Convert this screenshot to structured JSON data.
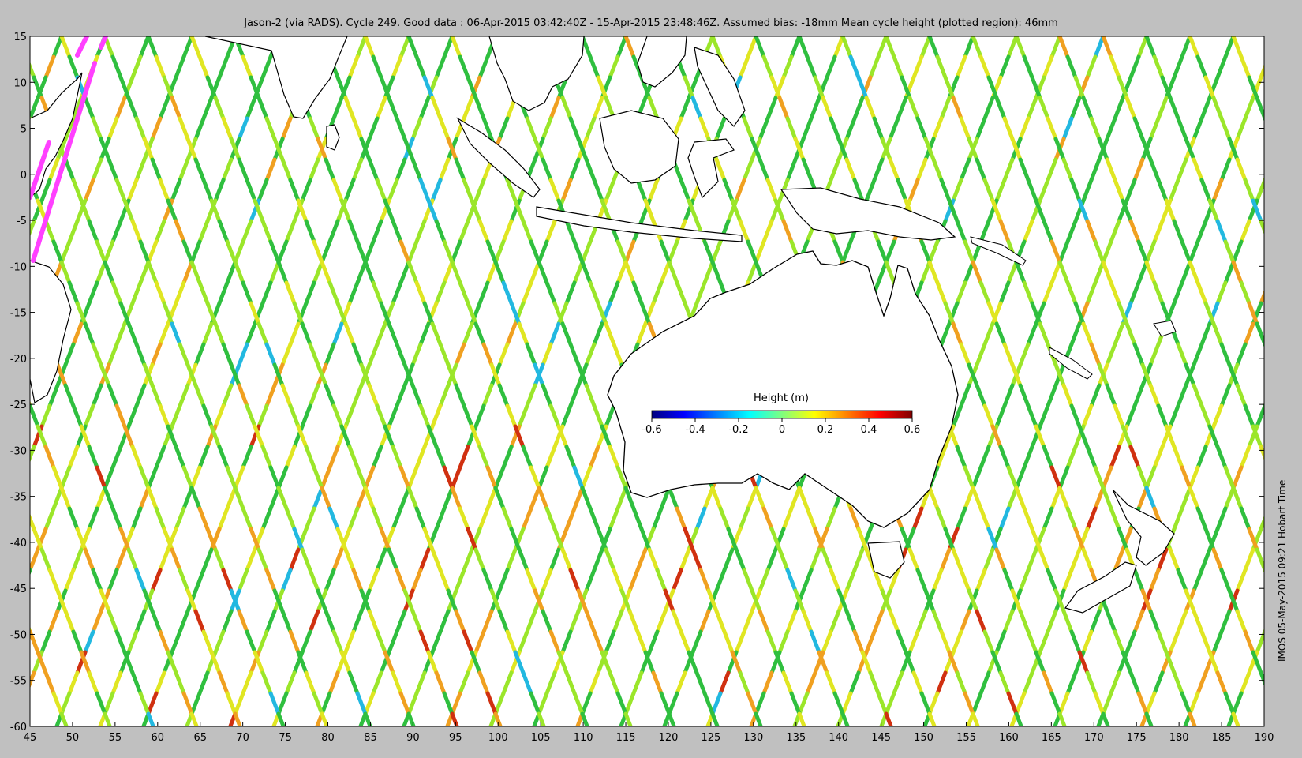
{
  "title": "Jason-2 (via RADS). Cycle 249. Good data : 06-Apr-2015 03:42:40Z - 15-Apr-2015 23:48:46Z. Assumed bias: -18mm  Mean cycle height (plotted region): 46mm",
  "side_label": "IMOS 05-May-2015 09:21 Hobart Time",
  "colorbar": {
    "title": "Height (m)",
    "ticks": [
      "-0.6",
      "-0.4",
      "-0.2",
      "0",
      "0.2",
      "0.4",
      "0.6"
    ],
    "range": [
      -0.6,
      0.6
    ],
    "colors": [
      "#00007f",
      "#0000ff",
      "#007fff",
      "#00ffff",
      "#7fff7f",
      "#ffff00",
      "#ff7f00",
      "#ff0000",
      "#7f0000"
    ]
  },
  "axes": {
    "x_ticks": [
      "45",
      "50",
      "55",
      "60",
      "65",
      "70",
      "75",
      "80",
      "85",
      "90",
      "95",
      "100",
      "105",
      "110",
      "115",
      "120",
      "125",
      "130",
      "135",
      "140",
      "145",
      "150",
      "155",
      "160",
      "165",
      "170",
      "175",
      "180",
      "185",
      "190"
    ],
    "y_ticks": [
      "15",
      "10",
      "5",
      "0",
      "-5",
      "-10",
      "-15",
      "-20",
      "-25",
      "-30",
      "-35",
      "-40",
      "-45",
      "-50",
      "-55",
      "-60"
    ],
    "x_range": [
      45,
      190
    ],
    "y_range": [
      -60,
      15
    ]
  },
  "map": {
    "land_color": "#ffffff",
    "coast_color": "#000000",
    "track_colors": {
      "green": "#2fbf3f",
      "yellowgreen": "#9be62a",
      "yellow": "#e0e622",
      "orange": "#f0a020",
      "red": "#d03010",
      "cyan": "#22b8e0",
      "magenta": "#ff40ff"
    }
  }
}
